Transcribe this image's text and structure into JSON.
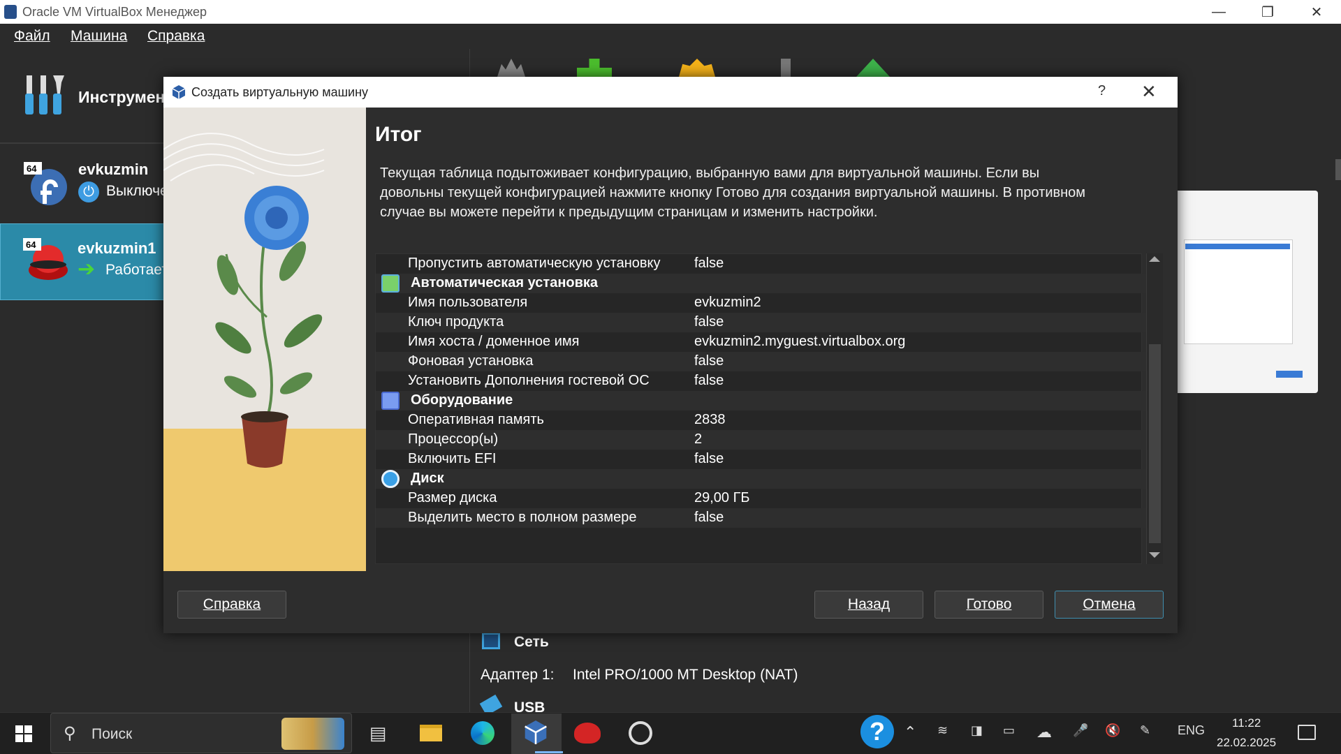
{
  "window": {
    "title": "Oracle VM VirtualBox Менеджер"
  },
  "menu": [
    "Файл",
    "Машина",
    "Справка"
  ],
  "tools": {
    "label": "Инструменты"
  },
  "vms": [
    {
      "name": "evkuzmin",
      "state": "Выключена",
      "badge": "64"
    },
    {
      "name": "evkuzmin1",
      "state": "Работает",
      "badge": "64"
    }
  ],
  "details": {
    "network_title": "Сеть",
    "adapter_label": "Адаптер 1:",
    "adapter_value": "Intel PRO/1000 MT Desktop (NAT)",
    "usb_title": "USB"
  },
  "dialog": {
    "title": "Создать виртуальную машину",
    "help_glyph": "?",
    "heading": "Итог",
    "description": "Текущая таблица подытоживает конфигурацию, выбранную вами для виртуальной машины. Если вы довольны текущей конфигурацией нажмите кнопку Готово для создания виртуальной машины. В противном случае вы можете перейти к предыдущим страницам и изменить настройки.",
    "rows": [
      {
        "type": "item",
        "key": "Пропустить автоматическую установку",
        "value": "false"
      },
      {
        "type": "section",
        "key": "Автоматическая установка",
        "icon": "unattended-install-icon"
      },
      {
        "type": "item",
        "key": "Имя пользователя",
        "value": "evkuzmin2"
      },
      {
        "type": "item",
        "key": "Ключ продукта",
        "value": "false"
      },
      {
        "type": "item",
        "key": "Имя хоста / доменное имя",
        "value": "evkuzmin2.myguest.virtualbox.org"
      },
      {
        "type": "item",
        "key": "Фоновая установка",
        "value": "false"
      },
      {
        "type": "item",
        "key": "Установить Дополнения гостевой ОС",
        "value": "false"
      },
      {
        "type": "section",
        "key": "Оборудование",
        "icon": "hardware-icon"
      },
      {
        "type": "item",
        "key": "Оперативная память",
        "value": "2838"
      },
      {
        "type": "item",
        "key": "Процессор(ы)",
        "value": "2"
      },
      {
        "type": "item",
        "key": "Включить EFI",
        "value": "false"
      },
      {
        "type": "section",
        "key": "Диск",
        "icon": "disk-icon"
      },
      {
        "type": "item",
        "key": "Размер диска",
        "value": "29,00 ГБ"
      },
      {
        "type": "item",
        "key": "Выделить место в полном размере",
        "value": "false"
      }
    ],
    "buttons": {
      "help": "Справка",
      "back": "Назад",
      "finish": "Готово",
      "cancel": "Отмена"
    }
  },
  "taskbar": {
    "search_placeholder": "Поиск",
    "lang": "ENG",
    "time": "11:22",
    "date": "22.02.2025"
  },
  "colors": {
    "accent": "#2a7d9c",
    "selected_vm": "#2b8aa8",
    "dialog_bg": "#2d2d2d"
  }
}
